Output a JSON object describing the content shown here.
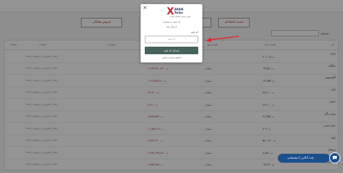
{
  "tabs": [
    {
      "label": "قیمت لحظه‌ای",
      "active": true
    },
    {
      "label": "لیست تامین‌کنندگان",
      "active": false
    },
    {
      "label": "فروش هفتگی",
      "active": false
    }
  ],
  "search": {
    "label": "جستجو:",
    "placeholder": ""
  },
  "table": {
    "columns": [
      "نام",
      "قیمت خرید",
      "قیمت روز",
      "حجم معاملات",
      "تغییرات",
      "عملیات",
      "معامله"
    ],
    "rows": [
      {
        "name": "ورق",
        "sub": "",
        "price": "۴۰,۱۰۵ ت",
        "r1": "",
        "vol": "۱,۲۳۰,۸۰ تن",
        "dash": "-",
        "acts": "اعلام | فروش | ویرایش | اعلان"
      },
      {
        "name": "میلگرد",
        "sub": "",
        "price": "۶۳,۵۶۱ ت",
        "r1": "میلیارد",
        "vol": "۱,۲۷۳,۳۹۰,۴۲۰ ت",
        "dash": "-",
        "acts": "اعلام | فروش | ویرایش | اعلان"
      },
      {
        "name": "آلومینیوم",
        "sub": "",
        "price": "۱۳,۷۵۴ ت",
        "r1": "میلیارد",
        "vol": "۱۰۳,۲۲۵,۲۸۰ ت",
        "dash": "-",
        "acts": "اعلام | فروش | ویرایش | اعلان"
      },
      {
        "name": "کاتد",
        "sub": "",
        "price": "۸۸,۷۰۰ ت",
        "r1": "میلیارد",
        "vol": "۲۷,۹۶۰ ت",
        "dash": "-",
        "acts": "اعلام | فروش | ویرایش | اعلان"
      },
      {
        "name": "نبشی",
        "sub": "",
        "price": "۴۸,۲۰۰ ت",
        "r1": "میلیارد",
        "vol": "۳,۷۶۰ ت",
        "dash": "-",
        "acts": "اعلام | فروش | ویرایش | اعلان"
      },
      {
        "name": "ورق رنگی",
        "sub": "",
        "price": "۹۱,۳۵۲ ت",
        "r1": "میلیارد",
        "vol": "۹,۵۹۷,۵۹۲ ت",
        "dash": "-",
        "acts": "اعلام | فروش | ویرایش | اعلان"
      },
      {
        "name": "سیم مسی",
        "sub": "",
        "price": "۷۰۲ ت",
        "r1": "میلیارد",
        "vol": "۱,۱۷۵,۲۰۸ ت",
        "dash": "-",
        "acts": "اعلام | فروش | ویرایش | اعلان"
      },
      {
        "name": "لوله",
        "sub": "",
        "price": "۵۸۰,۴۶۰ ت",
        "r1": "میلیارد",
        "vol": "۱,۹۲۲,۲۶۰ ت",
        "dash": "-",
        "acts": "اعلام | فروش | ویرایش | اعلان"
      },
      {
        "name": "پروفیل",
        "sub": "",
        "price": "۸,۳۵۰ ت",
        "r1": "میلیارد",
        "vol": "۲,۸۴۴,۱۹۸,۸۳۰ ت",
        "dash": "-",
        "acts": "اعلام | فروش | ویرایش | اعلان"
      },
      {
        "name": "تیرآهن",
        "sub": "",
        "price": "۱۷,۴۹۰ ت",
        "r1": "میلیارد",
        "vol": "۱,۸۵۲,۲۵۶ ت",
        "dash": "-",
        "acts": "اعلام | فروش | ویرایش | اعلان"
      }
    ]
  },
  "modal": {
    "logo_mark": "X",
    "logo_line1": "ARAN",
    "logo_line2": "Tellar",
    "logo_tagline": "اولین سامانه معاملات فلزات",
    "hint": "کد تایید به شماره",
    "phone": "ارسال شد",
    "code_label": "کد تایید",
    "code_placeholder": "کد تایید",
    "submit_label": "ارسال کد تایید",
    "fix_link": "اصلاح شماره تماس"
  },
  "chat": {
    "label": "چت آنلاین با پشتیبانی"
  },
  "colors": {
    "accent": "#b5262d",
    "brand": "#1f3a6b",
    "submit": "#45625c",
    "chat": "#1b4f8c"
  }
}
